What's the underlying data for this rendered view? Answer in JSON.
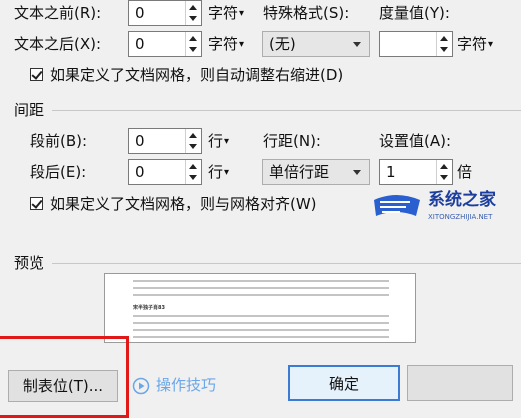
{
  "indent": {
    "before_label": "文本之前(R):",
    "before_value": "0",
    "before_unit": "字符",
    "after_label": "文本之后(X):",
    "after_value": "0",
    "after_unit": "字符",
    "special_label": "特殊格式(S):",
    "special_value": "(无)",
    "measure_label": "度量值(Y):",
    "measure_value": "",
    "measure_unit": "字符",
    "grid_checkbox_label": "如果定义了文档网格，则自动调整右缩进(D)",
    "grid_checkbox_checked": true
  },
  "spacing": {
    "section_title": "间距",
    "before_label": "段前(B):",
    "before_value": "0",
    "before_unit": "行",
    "after_label": "段后(E):",
    "after_value": "0",
    "after_unit": "行",
    "line_spacing_label": "行距(N):",
    "line_spacing_value": "单倍行距",
    "set_value_label": "设置值(A):",
    "set_value": "1",
    "set_value_unit": "倍",
    "grid_checkbox_label": "如果定义了文档网格，则与网格对齐(W)",
    "grid_checkbox_checked": true
  },
  "preview": {
    "section_title": "预览",
    "sample_text": "宋半独子肖83"
  },
  "buttons": {
    "tabs_label": "制表位(T)...",
    "tips_label": "操作技巧",
    "ok_label": "确定"
  },
  "watermark": {
    "brand": "系统之家",
    "url": "XITONGZHIJIA.NET"
  },
  "colors": {
    "highlight_border": "#e01818",
    "tips_icon": "#6aa6e8",
    "watermark_blue": "#2a5fcf"
  }
}
